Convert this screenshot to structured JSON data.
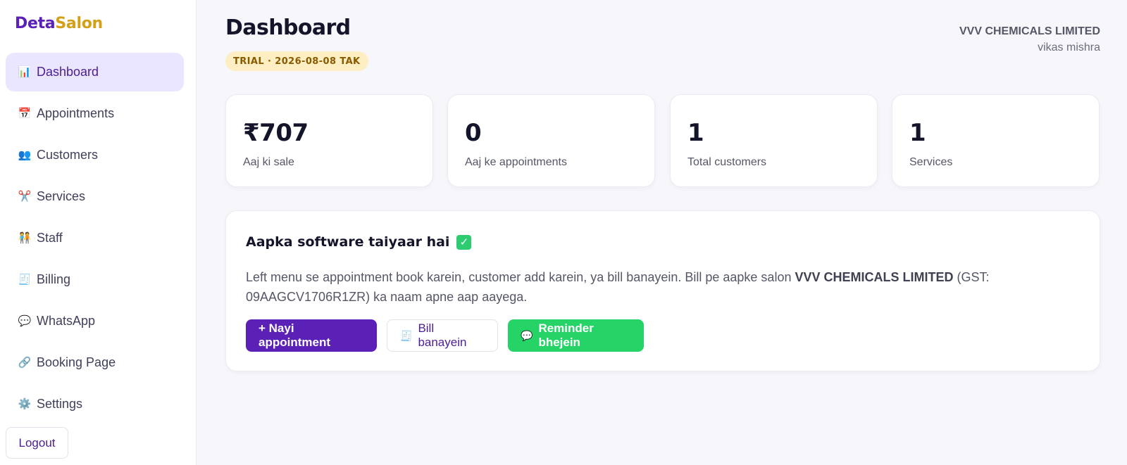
{
  "brand": {
    "part1": "Deta",
    "part2": "Salon"
  },
  "sidebar": {
    "items": [
      {
        "label": "Dashboard",
        "icon": "📊",
        "active": true
      },
      {
        "label": "Appointments",
        "icon": "📅"
      },
      {
        "label": "Customers",
        "icon": "👥"
      },
      {
        "label": "Services",
        "icon": "✂️"
      },
      {
        "label": "Staff",
        "icon": "🧑‍🤝‍🧑"
      },
      {
        "label": "Billing",
        "icon": "🧾"
      },
      {
        "label": "WhatsApp",
        "icon": "💬"
      },
      {
        "label": "Booking Page",
        "icon": "🔗"
      },
      {
        "label": "Settings",
        "icon": "⚙️"
      }
    ],
    "logout_label": "Logout"
  },
  "header": {
    "title": "Dashboard",
    "trial_badge": "TRIAL · 2026-08-08 TAK",
    "company": "VVV CHEMICALS LIMITED",
    "user": "vikas mishra"
  },
  "stats": [
    {
      "value": "₹707",
      "label": "Aaj ki sale"
    },
    {
      "value": "0",
      "label": "Aaj ke appointments"
    },
    {
      "value": "1",
      "label": "Total customers"
    },
    {
      "value": "1",
      "label": "Services"
    }
  ],
  "info": {
    "title": "Aapka software taiyaar hai",
    "text_before": "Left menu se appointment book karein, customer add karein, ya bill banayein. Bill pe aapke salon ",
    "company": "VVV CHEMICALS LIMITED",
    "text_after": " (GST: 09AAGCV1706R1ZR) ka naam apne aap aayega.",
    "buttons": {
      "new_appointment": "+ Nayi appointment",
      "bill": "Bill banayein",
      "reminder": "Reminder bhejein"
    }
  },
  "colors": {
    "accent": "#5b21b6",
    "brand_gold": "#d4a017",
    "whatsapp_green": "#25d366",
    "active_bg": "#ebe6ff",
    "trial_bg": "#fdefc3"
  }
}
